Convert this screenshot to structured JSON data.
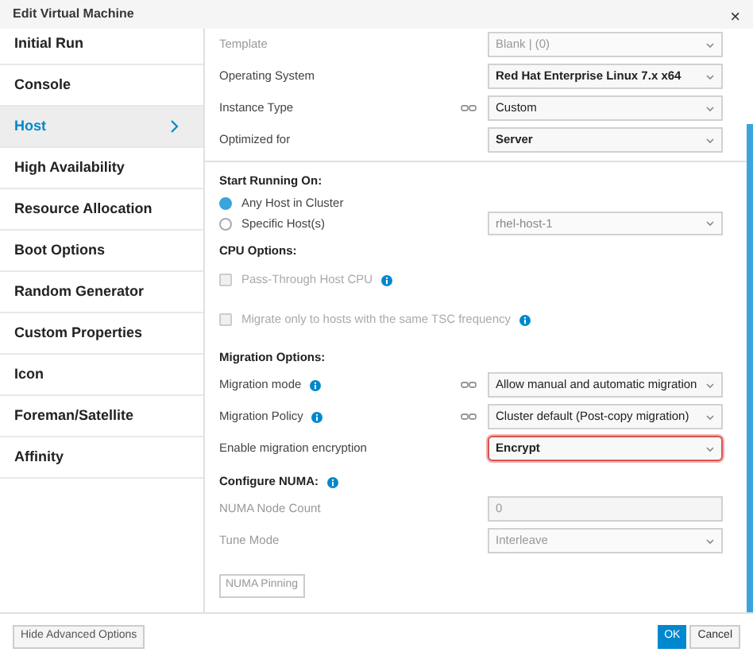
{
  "window": {
    "title": "Edit Virtual Machine",
    "close_button": "×"
  },
  "sidebar": {
    "items": [
      {
        "label": "Initial Run",
        "selected": false
      },
      {
        "label": "Console",
        "selected": false
      },
      {
        "label": "Host",
        "selected": true
      },
      {
        "label": "High Availability",
        "selected": false
      },
      {
        "label": "Resource Allocation",
        "selected": false
      },
      {
        "label": "Boot Options",
        "selected": false
      },
      {
        "label": "Random Generator",
        "selected": false
      },
      {
        "label": "Custom Properties",
        "selected": false
      },
      {
        "label": "Icon",
        "selected": false
      },
      {
        "label": "Foreman/Satellite",
        "selected": false
      },
      {
        "label": "Affinity",
        "selected": false
      }
    ]
  },
  "general_fields": [
    {
      "label": "Template",
      "kind": "select",
      "value": "Blank | (0)",
      "disabled": true,
      "linked": false
    },
    {
      "label": "Operating System",
      "kind": "select",
      "value": "Red Hat Enterprise Linux 7.x x64",
      "disabled": false,
      "linked": false
    },
    {
      "label": "Instance Type",
      "kind": "select",
      "value": "Custom",
      "disabled": false,
      "linked": true
    },
    {
      "label": "Optimized for",
      "kind": "select",
      "value": "Server",
      "disabled": false,
      "linked": false
    }
  ],
  "start_running_on": {
    "heading": "Start Running On:",
    "options": [
      {
        "label": "Any Host in Cluster",
        "selected": true
      },
      {
        "label": "Specific Host(s)",
        "selected": false,
        "host_select": "rhel-host-1"
      }
    ]
  },
  "cpu_options": {
    "heading": "CPU Options:",
    "checkboxes": [
      {
        "label": "Pass-Through Host CPU",
        "checked": false,
        "disabled": true,
        "info": true
      },
      {
        "label": "Migrate only to hosts with the same TSC frequency",
        "checked": false,
        "disabled": true,
        "info": true
      }
    ]
  },
  "migration_options": {
    "heading": "Migration Options:",
    "fields": [
      {
        "label": "Migration mode",
        "kind": "select",
        "info": true,
        "linked": true,
        "value": "Allow manual and automatic migration",
        "highlighted": false
      },
      {
        "label": "Migration Policy",
        "kind": "select",
        "info": true,
        "linked": true,
        "value": "Cluster default (Post-copy migration)",
        "highlighted": false
      },
      {
        "label": "Enable migration encryption",
        "kind": "select",
        "info": false,
        "linked": false,
        "value": "Encrypt",
        "highlighted": true
      }
    ]
  },
  "numa": {
    "heading": "Configure NUMA:",
    "info": true,
    "fields": [
      {
        "label": "NUMA Node Count",
        "kind": "input",
        "value": "0",
        "disabled": true
      },
      {
        "label": "Tune Mode",
        "kind": "select",
        "value": "Interleave",
        "disabled": true
      }
    ],
    "pinning_button": "NUMA Pinning"
  },
  "footer": {
    "hide_advanced_button": "Hide Advanced Options",
    "ok_button": "OK",
    "cancel_button": "Cancel"
  }
}
